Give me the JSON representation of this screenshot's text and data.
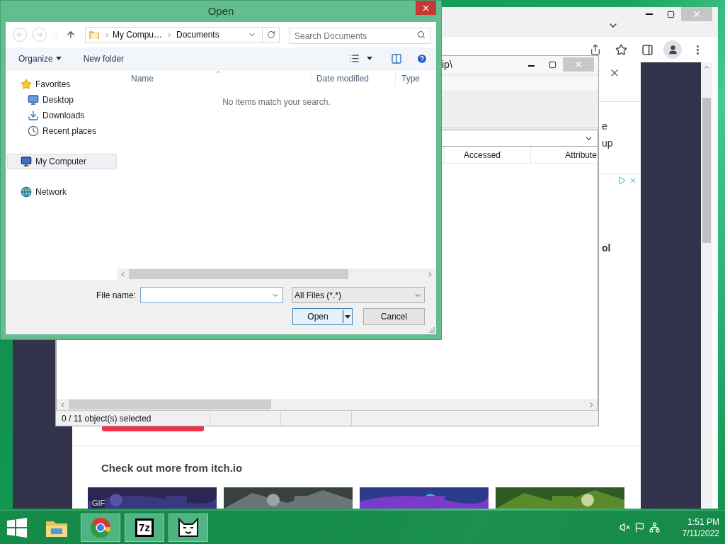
{
  "browser": {
    "page": {
      "fragments": [
        "e",
        "up",
        "ol"
      ],
      "section_title": "Check out more from itch.io",
      "thumbnails": [
        {
          "kind": "picture",
          "badge": "GIF"
        },
        {
          "kind": "picture"
        },
        {
          "kind": "picture"
        },
        {
          "kind": "picture"
        }
      ]
    }
  },
  "file_manager": {
    "title": "ip\\",
    "columns": [
      "Accessed",
      "Attribute"
    ],
    "status": "0 / 11 object(s) selected"
  },
  "open_dialog": {
    "title": "Open",
    "nav_buttons": [
      {
        "kind": "back",
        "disabled": true
      },
      {
        "kind": "forward",
        "disabled": true
      },
      {
        "kind": "recent",
        "disabled": true
      },
      {
        "kind": "up",
        "disabled": false
      }
    ],
    "breadcrumb": [
      "My Compu…",
      "Documents"
    ],
    "search": {
      "placeholder": "Search Documents"
    },
    "toolbar": {
      "organize": "Organize",
      "new_folder": "New folder"
    },
    "nav_tree": [
      {
        "label": "Favorites",
        "kind": "favorites",
        "selected": false,
        "children": [
          {
            "label": "Desktop",
            "kind": "desktop",
            "selected": false
          },
          {
            "label": "Downloads",
            "kind": "downloads",
            "selected": false
          },
          {
            "label": "Recent places",
            "kind": "recent",
            "selected": false
          }
        ]
      },
      {
        "label": "My Computer",
        "kind": "computer",
        "selected": true
      },
      {
        "label": "Network",
        "kind": "network",
        "selected": false
      }
    ],
    "columns": [
      "Name",
      "Date modified",
      "Type"
    ],
    "empty_message": "No items match your search.",
    "file_name": {
      "label": "File name:"
    },
    "file_type": "All Files (*.*)",
    "buttons": [
      {
        "label": "Open",
        "kind": "split"
      },
      {
        "label": "Cancel",
        "kind": "plain"
      }
    ]
  },
  "taskbar": {
    "apps": [
      {
        "kind": "explorer",
        "running": false
      },
      {
        "kind": "chrome",
        "running": true
      },
      {
        "kind": "archiver",
        "running": true,
        "label": "7z"
      },
      {
        "kind": "cat",
        "running": true
      }
    ],
    "time": "1:51 PM",
    "date": "7/11/2022"
  }
}
